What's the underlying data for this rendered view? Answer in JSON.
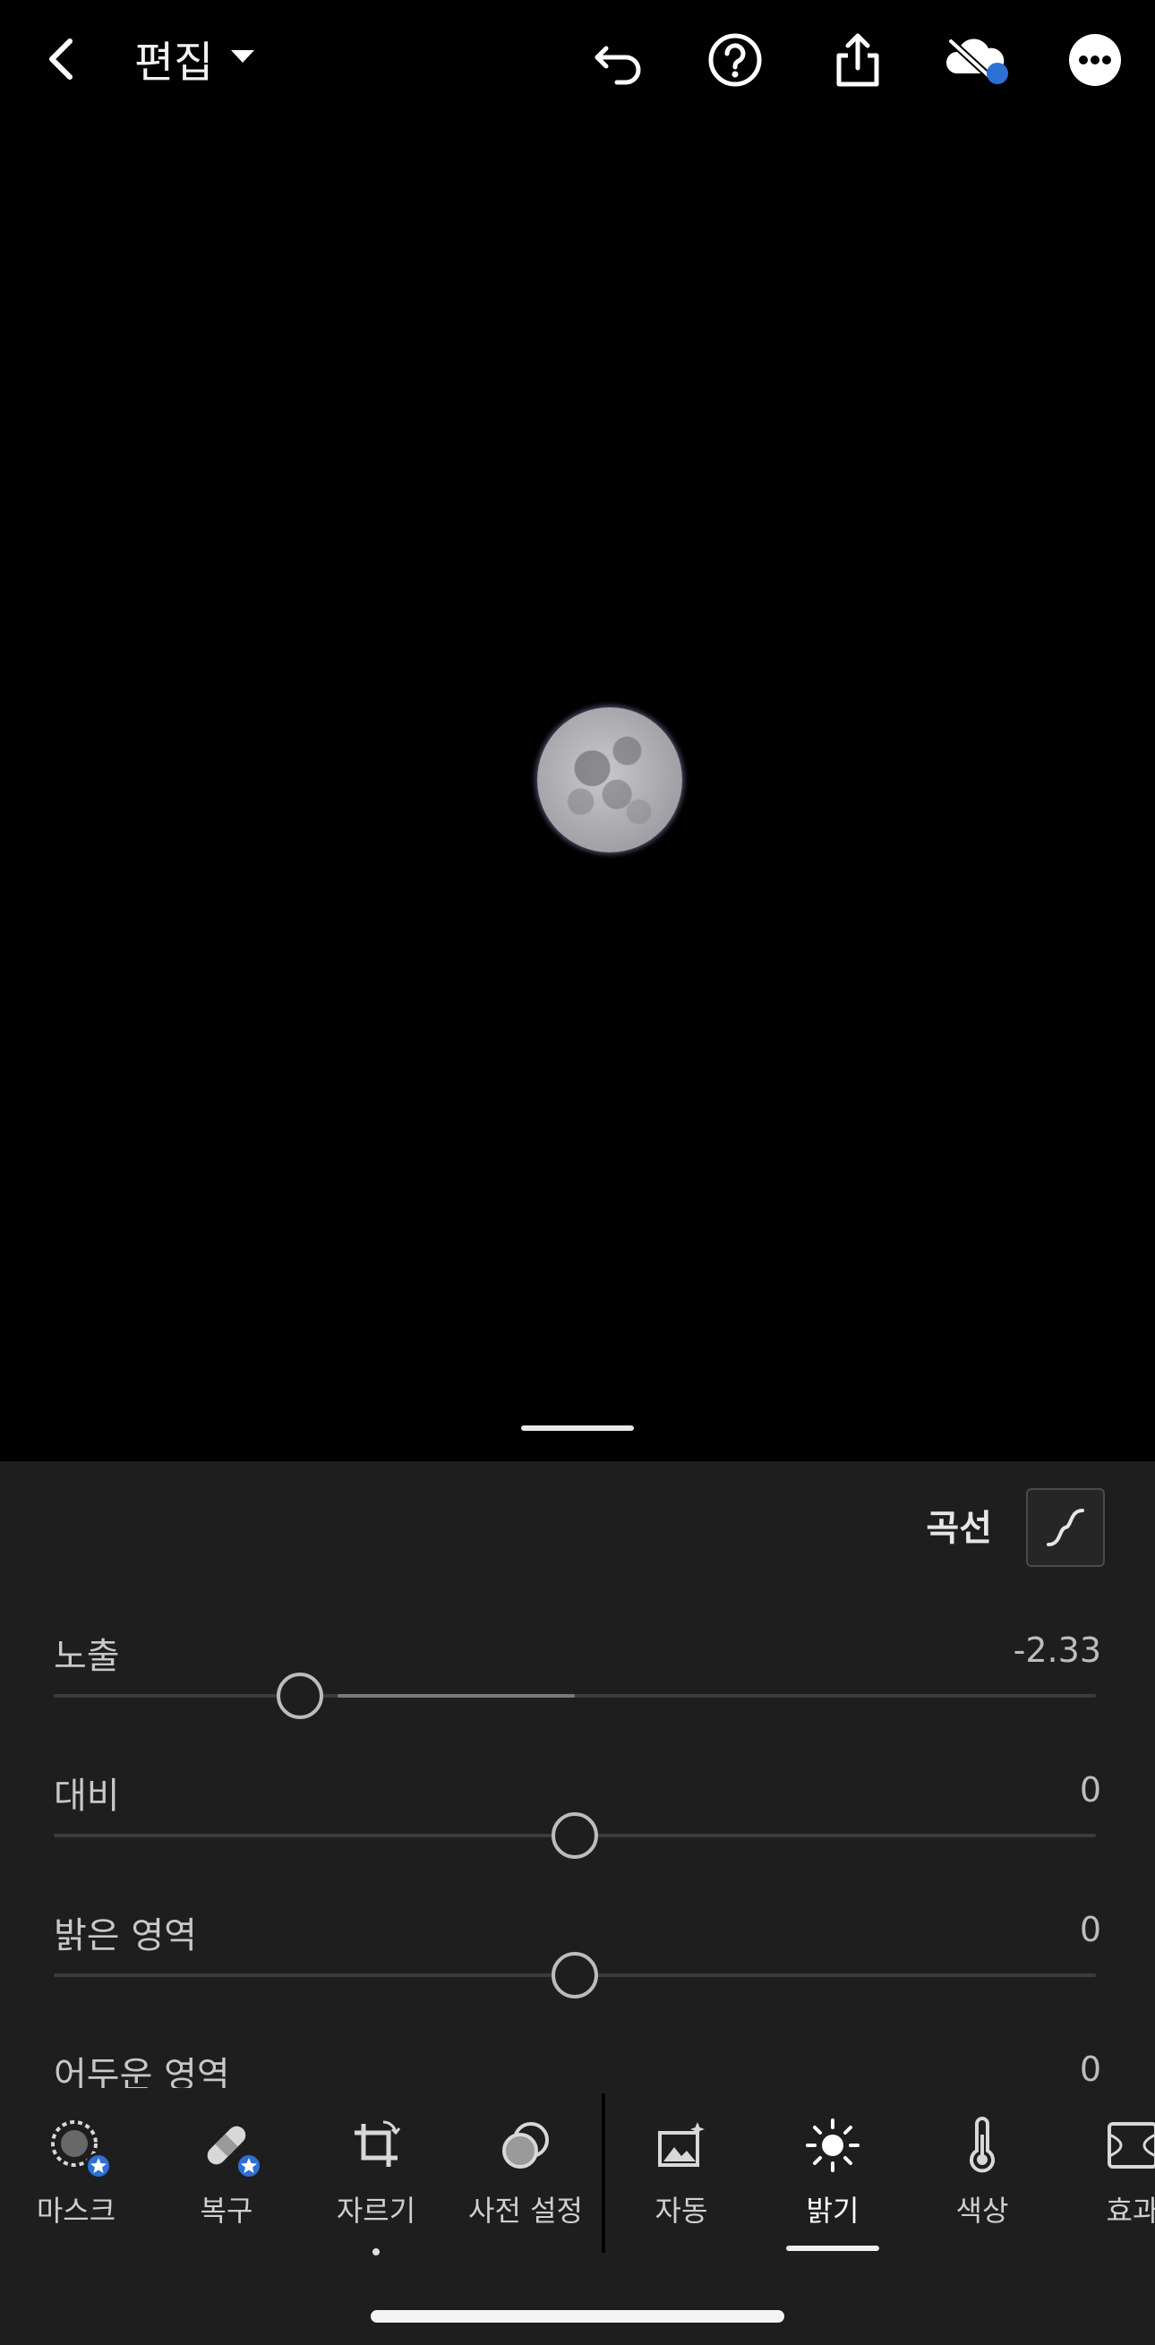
{
  "header": {
    "mode_label": "편집",
    "icons": [
      "back-arrow-icon",
      "chevron-down-icon",
      "undo-icon",
      "help-icon",
      "share-icon",
      "cloud-sync-off-icon",
      "more-icon"
    ],
    "sync_dot_color": "#2e6fd6"
  },
  "panel": {
    "curve_label": "곡선",
    "sliders": [
      {
        "label": "노출",
        "value": "-2.33",
        "position": 0.236
      },
      {
        "label": "대비",
        "value": "0",
        "position": 0.5
      },
      {
        "label": "밝은 영역",
        "value": "0",
        "position": 0.5
      },
      {
        "label": "어두운 영역",
        "value": "0",
        "position": 0.5
      }
    ]
  },
  "toolbar": {
    "items": [
      {
        "label": "마스크",
        "icon": "mask-icon",
        "premium": true
      },
      {
        "label": "복구",
        "icon": "healing-bandage-icon",
        "premium": true
      },
      {
        "label": "자르기",
        "icon": "crop-icon",
        "premium": false
      },
      {
        "label": "사전 설정",
        "icon": "presets-icon",
        "premium": false
      },
      {
        "label": "자동",
        "icon": "auto-icon",
        "premium": false
      },
      {
        "label": "밝기",
        "icon": "light-sun-icon",
        "premium": false,
        "active": true
      },
      {
        "label": "색상",
        "icon": "thermometer-icon",
        "premium": false
      },
      {
        "label": "효과",
        "icon": "effects-icon",
        "premium": false
      }
    ]
  },
  "colors": {
    "accent": "#2e6fd6",
    "panel_bg": "#1e1e1e"
  }
}
